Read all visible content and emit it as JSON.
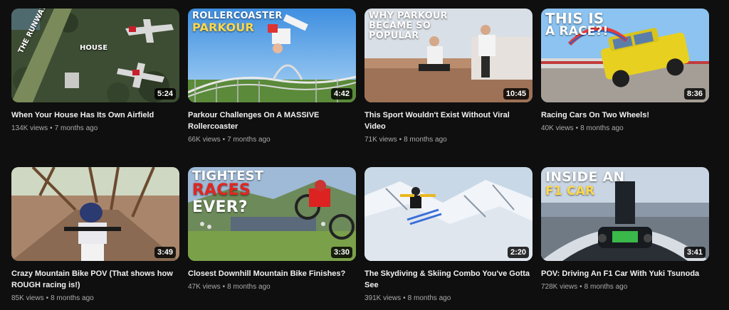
{
  "videos": [
    {
      "title": "When Your House Has Its Own Airfield",
      "views": "134K views",
      "age": "7 months ago",
      "duration": "5:24",
      "thumb_text": {
        "runway": "THE RUNWAY",
        "house": "HOUSE"
      }
    },
    {
      "title": "Parkour Challenges On A MASSIVE Rollercoaster",
      "views": "66K views",
      "age": "7 months ago",
      "duration": "4:42",
      "thumb_text": {
        "line1": "ROLLERCOASTER",
        "line2": "PARKOUR"
      }
    },
    {
      "title": "This Sport Wouldn't Exist Without Viral Video",
      "views": "71K views",
      "age": "8 months ago",
      "duration": "10:45",
      "thumb_text": {
        "line1": "WHY PARKOUR",
        "line2": "BECAME SO",
        "line3": "POPULAR"
      }
    },
    {
      "title": "Racing Cars On Two Wheels!",
      "views": "40K views",
      "age": "8 months ago",
      "duration": "8:36",
      "thumb_text": {
        "line1": "THIS IS",
        "line2": "A RACE?!"
      }
    },
    {
      "title": "Crazy Mountain Bike POV (That shows how ROUGH racing is!)",
      "views": "85K views",
      "age": "8 months ago",
      "duration": "3:49"
    },
    {
      "title": "Closest Downhill Mountain Bike Finishes?",
      "views": "47K views",
      "age": "8 months ago",
      "duration": "3:30",
      "thumb_text": {
        "line1": "TIGHTEST",
        "line2": "RACES",
        "line3": "EVER?"
      }
    },
    {
      "title": "The Skydiving & Skiing Combo You've Gotta See",
      "views": "391K views",
      "age": "8 months ago",
      "duration": "2:20"
    },
    {
      "title": "POV: Driving An F1 Car With Yuki Tsunoda",
      "views": "728K views",
      "age": "8 months ago",
      "duration": "3:41",
      "thumb_text": {
        "line1": "INSIDE AN",
        "line2": "F1 CAR"
      }
    }
  ],
  "separator": "•",
  "colors": {
    "background": "#0f0f0f",
    "title": "#f1f1f1",
    "meta": "#aaaaaa",
    "accent_yellow": "#ffd84a",
    "accent_red": "#e2261f"
  }
}
